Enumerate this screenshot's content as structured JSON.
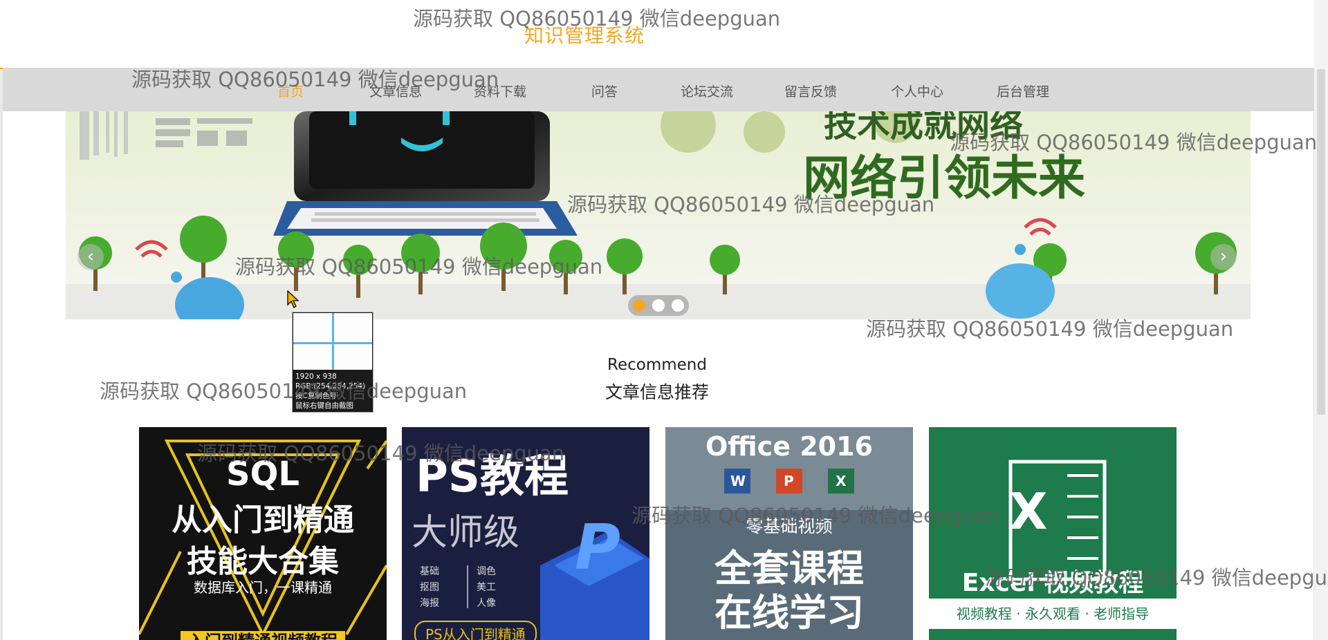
{
  "site_title": "知识管理系统",
  "nav": [
    "首页",
    "文章信息",
    "资料下载",
    "问答",
    "论坛交流",
    "留言反馈",
    "个人中心",
    "后台管理"
  ],
  "banner": {
    "headline_top": "技术成就网络",
    "headline": "网络引领未来",
    "prev_arrow": "‹",
    "next_arrow": "›",
    "active_slide": 1,
    "slide_count": 3
  },
  "capture_tooltip": {
    "size": "1920 x 938",
    "rgb": "RGB:(254,254,254)",
    "copy_hint": "按C复制色号",
    "rightclick_hint": "鼠标右键自由截图"
  },
  "section": {
    "en": "Recommend",
    "cn": "文章信息推荐"
  },
  "cards": [
    {
      "lines": [
        "SQL",
        "从入门到精通",
        "技能大合集"
      ],
      "sub": "数据库入门，一课精通",
      "bottom": "入门到精通视频教程"
    },
    {
      "title": "PS教程",
      "sub": "大师级",
      "tags": [
        "基础",
        "调色",
        "抠图",
        "美工",
        "海报",
        "人像"
      ],
      "bottom": "PS从入门到精通"
    },
    {
      "title": "Office 2016",
      "apps": [
        "W",
        "P",
        "X"
      ],
      "sub": "零基础视频",
      "lines": [
        "全套课程",
        "在线学习"
      ]
    },
    {
      "title": "Excel 视频教程",
      "sub": "视频教程 · 永久观看 · 老师指导",
      "icon": "X"
    }
  ],
  "watermark": "源码获取 QQ86050149 微信deepguan",
  "colors": {
    "accent": "#f5a623",
    "nav_bg": "#d9d9d9"
  }
}
